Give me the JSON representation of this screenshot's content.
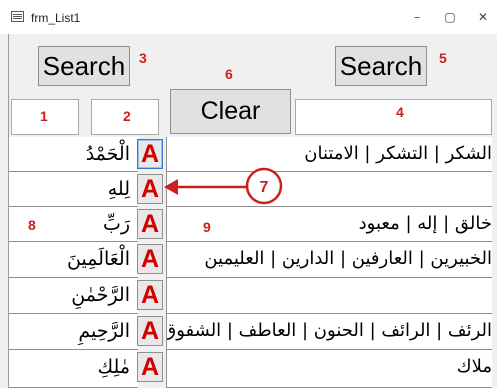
{
  "window": {
    "title": "frm_List1",
    "minimize": "–",
    "maximize": "▢",
    "close": "✕"
  },
  "toolbar": {
    "search_left_label": "Search",
    "search_right_label": "Search",
    "clear_label": "Clear"
  },
  "annotations": {
    "n1": "1",
    "n2": "2",
    "n3": "3",
    "n4": "4",
    "n5": "5",
    "n6": "6",
    "n7": "7",
    "n8": "8",
    "n9": "9"
  },
  "rows": [
    {
      "word": "الْحَمْدُ",
      "button": "A",
      "synonyms": "الشكر | التشكر | الامتنان"
    },
    {
      "word": "لِلهِ",
      "button": "A",
      "synonyms": ""
    },
    {
      "word": "رَبِّ",
      "button": "A",
      "synonyms": "خالق | إله | معبود"
    },
    {
      "word": "الْعَالَمِينَ",
      "button": "A",
      "synonyms": "الخبيرين | العارفين | الدارين | العليمين"
    },
    {
      "word": "الرَّحْمٰنِ",
      "button": "A",
      "synonyms": ""
    },
    {
      "word": "الرَّحِيمِ",
      "button": "A",
      "synonyms": "الرئف | الرائف | الحنون | العاطف | الشفوق"
    },
    {
      "word": "مٰلِكِ",
      "button": "A",
      "synonyms": "ملاك"
    }
  ],
  "colors": {
    "annotation": "#cc1f1f",
    "arrow": "#cc1f1f",
    "a_button_text": "#d40000"
  }
}
